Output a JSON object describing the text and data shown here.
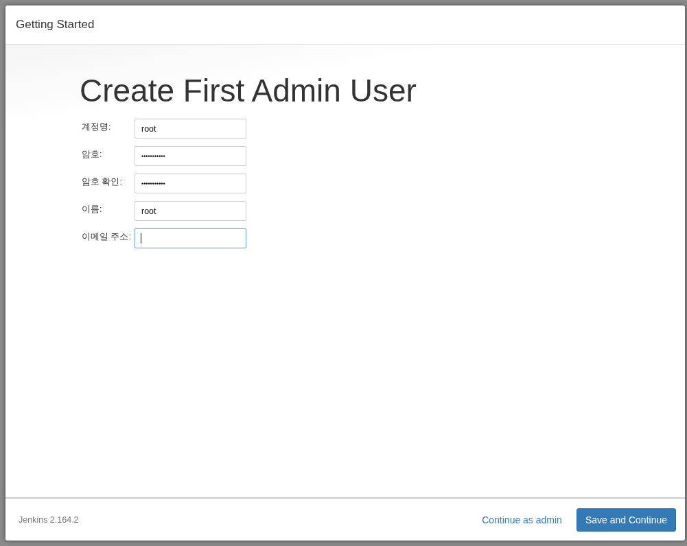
{
  "header": {
    "title": "Getting Started"
  },
  "heading": "Create First Admin User",
  "fields": [
    {
      "label": "계정명:",
      "kind": "text",
      "value": "root",
      "focused": false
    },
    {
      "label": "암호:",
      "kind": "password",
      "value": "•••••••••••",
      "focused": false
    },
    {
      "label": "암호 확인:",
      "kind": "password",
      "value": "•••••••••••",
      "focused": false
    },
    {
      "label": "이름:",
      "kind": "text",
      "value": "root",
      "focused": false
    },
    {
      "label": "이메일 주소:",
      "kind": "text",
      "focused": true
    }
  ],
  "footer": {
    "version": "Jenkins 2.164.2",
    "link": "Continue as admin",
    "button": "Save and Continue"
  }
}
